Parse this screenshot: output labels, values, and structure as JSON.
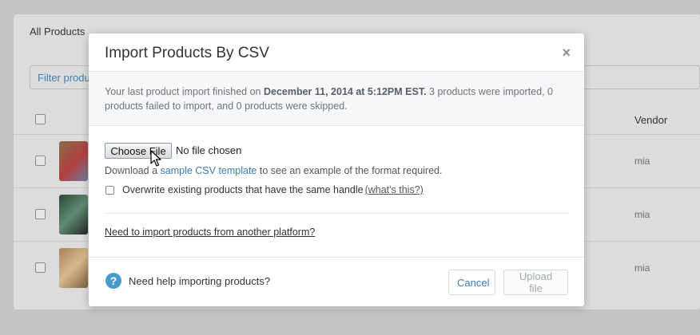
{
  "background": {
    "tab_label": "All Products",
    "filter_placeholder": "Filter products",
    "vendor_header": "Vendor",
    "rows": [
      {
        "vendor": "mia"
      },
      {
        "vendor": "mia"
      },
      {
        "vendor": "mia"
      }
    ]
  },
  "modal": {
    "title": "Import Products By CSV",
    "close_glyph": "×",
    "notice": {
      "prefix": "Your last product import finished on",
      "date": "December 11, 2014 at 5:12PM EST.",
      "suffix": " 3 products were imported, 0 products failed to import, and 0 products were skipped."
    },
    "file": {
      "button_label": "Choose File",
      "status": "No file chosen"
    },
    "download": {
      "prefix": "Download a ",
      "link": "sample CSV template",
      "suffix": " to see an example of the format required."
    },
    "overwrite": {
      "label": "Overwrite existing products that have the same handle",
      "link": "(what's this?)",
      "checked": false
    },
    "platform_link": "Need to import products from another platform?",
    "footer": {
      "help_glyph": "?",
      "help_text": "Need help importing products?",
      "cancel_label": "Cancel",
      "upload_label": "Upload file"
    }
  },
  "colors": {
    "accent": "#3a7bb4",
    "help_icon": "#479ccf",
    "overlay": "#c2c4c6"
  }
}
